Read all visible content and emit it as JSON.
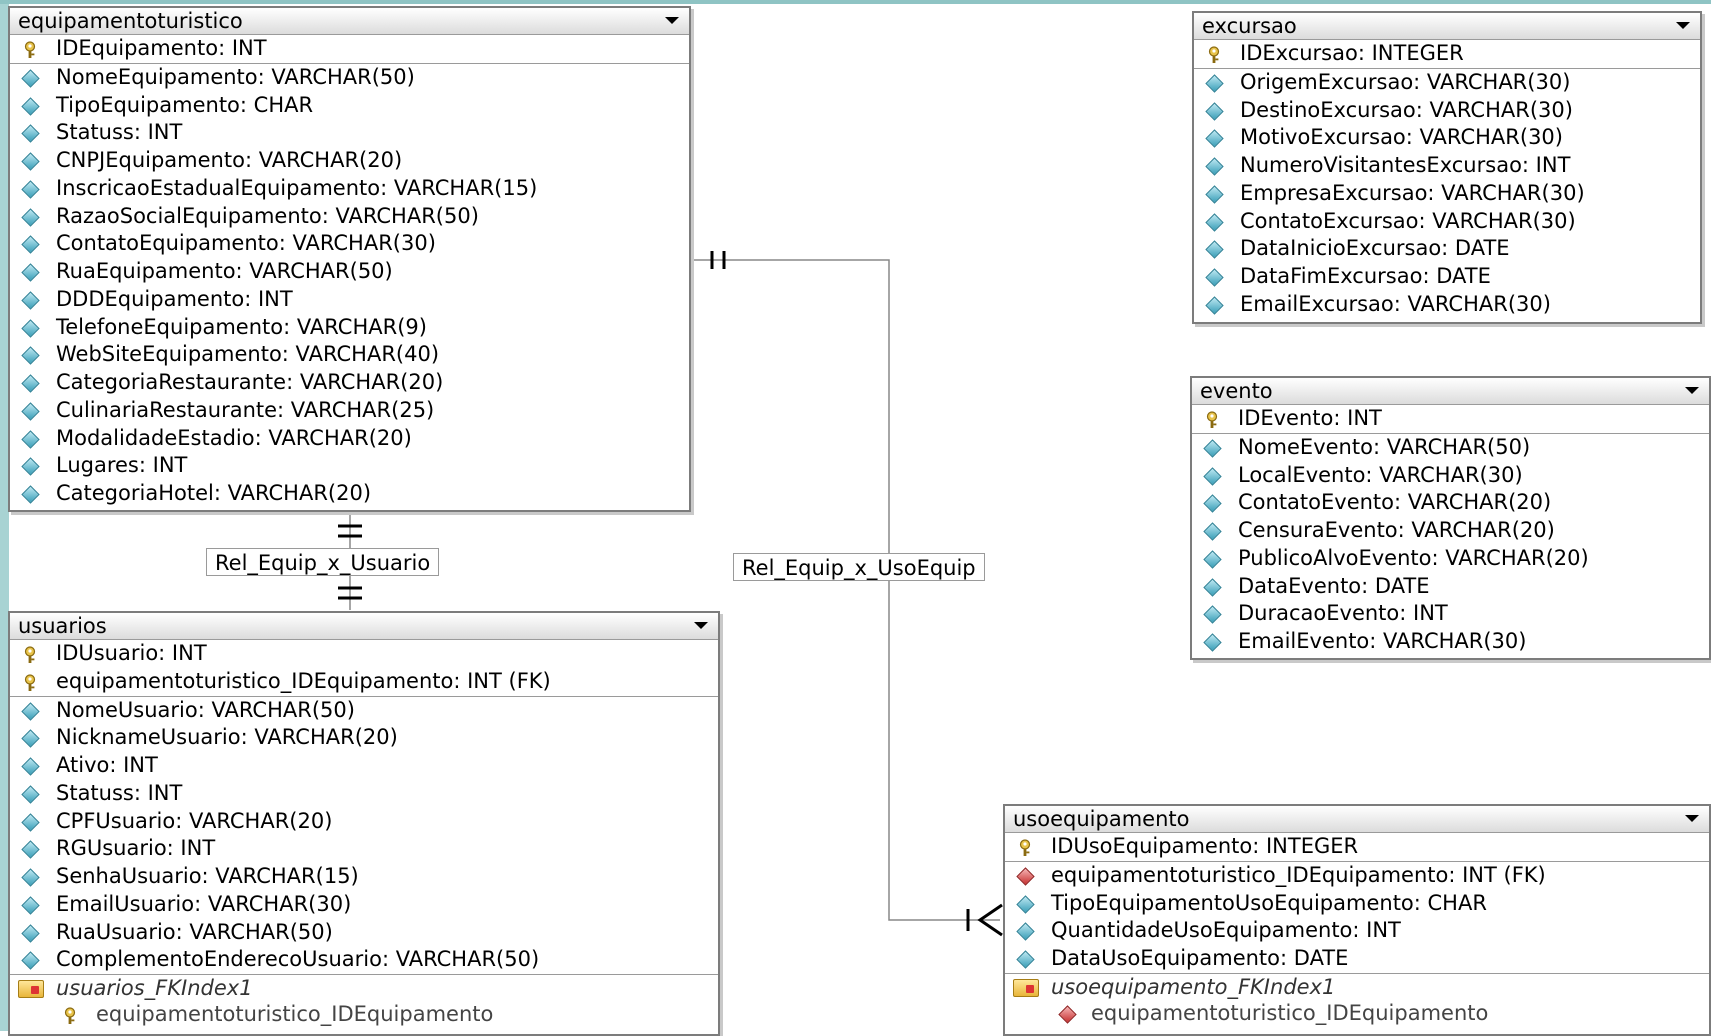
{
  "tables": {
    "equipamentoturistico": {
      "title": "equipamentoturistico",
      "pk": [
        "IDEquipamento: INT"
      ],
      "columns": [
        "NomeEquipamento: VARCHAR(50)",
        "TipoEquipamento: CHAR",
        "Statuss: INT",
        "CNPJEquipamento: VARCHAR(20)",
        "InscricaoEstadualEquipamento: VARCHAR(15)",
        "RazaoSocialEquipamento: VARCHAR(50)",
        "ContatoEquipamento: VARCHAR(30)",
        "RuaEquipamento: VARCHAR(50)",
        "DDDEquipamento: INT",
        "TelefoneEquipamento: VARCHAR(9)",
        "WebSiteEquipamento: VARCHAR(40)",
        "CategoriaRestaurante: VARCHAR(20)",
        "CulinariaRestaurante: VARCHAR(25)",
        "ModalidadeEstadio: VARCHAR(20)",
        "Lugares: INT",
        "CategoriaHotel: VARCHAR(20)"
      ]
    },
    "excursao": {
      "title": "excursao",
      "pk": [
        "IDExcursao: INTEGER"
      ],
      "columns": [
        "OrigemExcursao: VARCHAR(30)",
        "DestinoExcursao: VARCHAR(30)",
        "MotivoExcursao: VARCHAR(30)",
        "NumeroVisitantesExcursao: INT",
        "EmpresaExcursao: VARCHAR(30)",
        "ContatoExcursao: VARCHAR(30)",
        "DataInicioExcursao: DATE",
        "DataFimExcursao: DATE",
        "EmailExcursao: VARCHAR(30)"
      ]
    },
    "evento": {
      "title": "evento",
      "pk": [
        "IDEvento: INT"
      ],
      "columns": [
        "NomeEvento: VARCHAR(50)",
        "LocalEvento: VARCHAR(30)",
        "ContatoEvento: VARCHAR(20)",
        "CensuraEvento: VARCHAR(20)",
        "PublicoAlvoEvento: VARCHAR(20)",
        "DataEvento: DATE",
        "DuracaoEvento: INT",
        "EmailEvento: VARCHAR(30)"
      ]
    },
    "usuarios": {
      "title": "usuarios",
      "pk": [
        "IDUsuario: INT",
        "equipamentoturistico_IDEquipamento: INT (FK)"
      ],
      "columns": [
        "NomeUsuario: VARCHAR(50)",
        "NicknameUsuario: VARCHAR(20)",
        "Ativo: INT",
        "Statuss: INT",
        "CPFUsuario: VARCHAR(20)",
        "RGUsuario: INT",
        "SenhaUsuario: VARCHAR(15)",
        "EmailUsuario: VARCHAR(30)",
        "RuaUsuario: VARCHAR(50)",
        "ComplementoEnderecoUsuario: VARCHAR(50)"
      ],
      "index_name": "usuarios_FKIndex1",
      "index_column": "equipamentoturistico_IDEquipamento"
    },
    "usoequipamento": {
      "title": "usoequipamento",
      "pk": [
        "IDUsoEquipamento: INTEGER"
      ],
      "fk": [
        "equipamentoturistico_IDEquipamento: INT (FK)"
      ],
      "columns": [
        "TipoEquipamentoUsoEquipamento: CHAR",
        "QuantidadeUsoEquipamento: INT",
        "DataUsoEquipamento: DATE"
      ],
      "index_name": "usoequipamento_FKIndex1",
      "index_column": "equipamentoturistico_IDEquipamento"
    }
  },
  "relationships": {
    "rel1": "Rel_Equip_x_Usuario",
    "rel2": "Rel_Equip_x_UsoEquip"
  },
  "colors": {
    "line": "#888888",
    "attr_icon": "#3a9fb8",
    "fk_icon": "#c63030",
    "key_icon": "#c9a227"
  }
}
